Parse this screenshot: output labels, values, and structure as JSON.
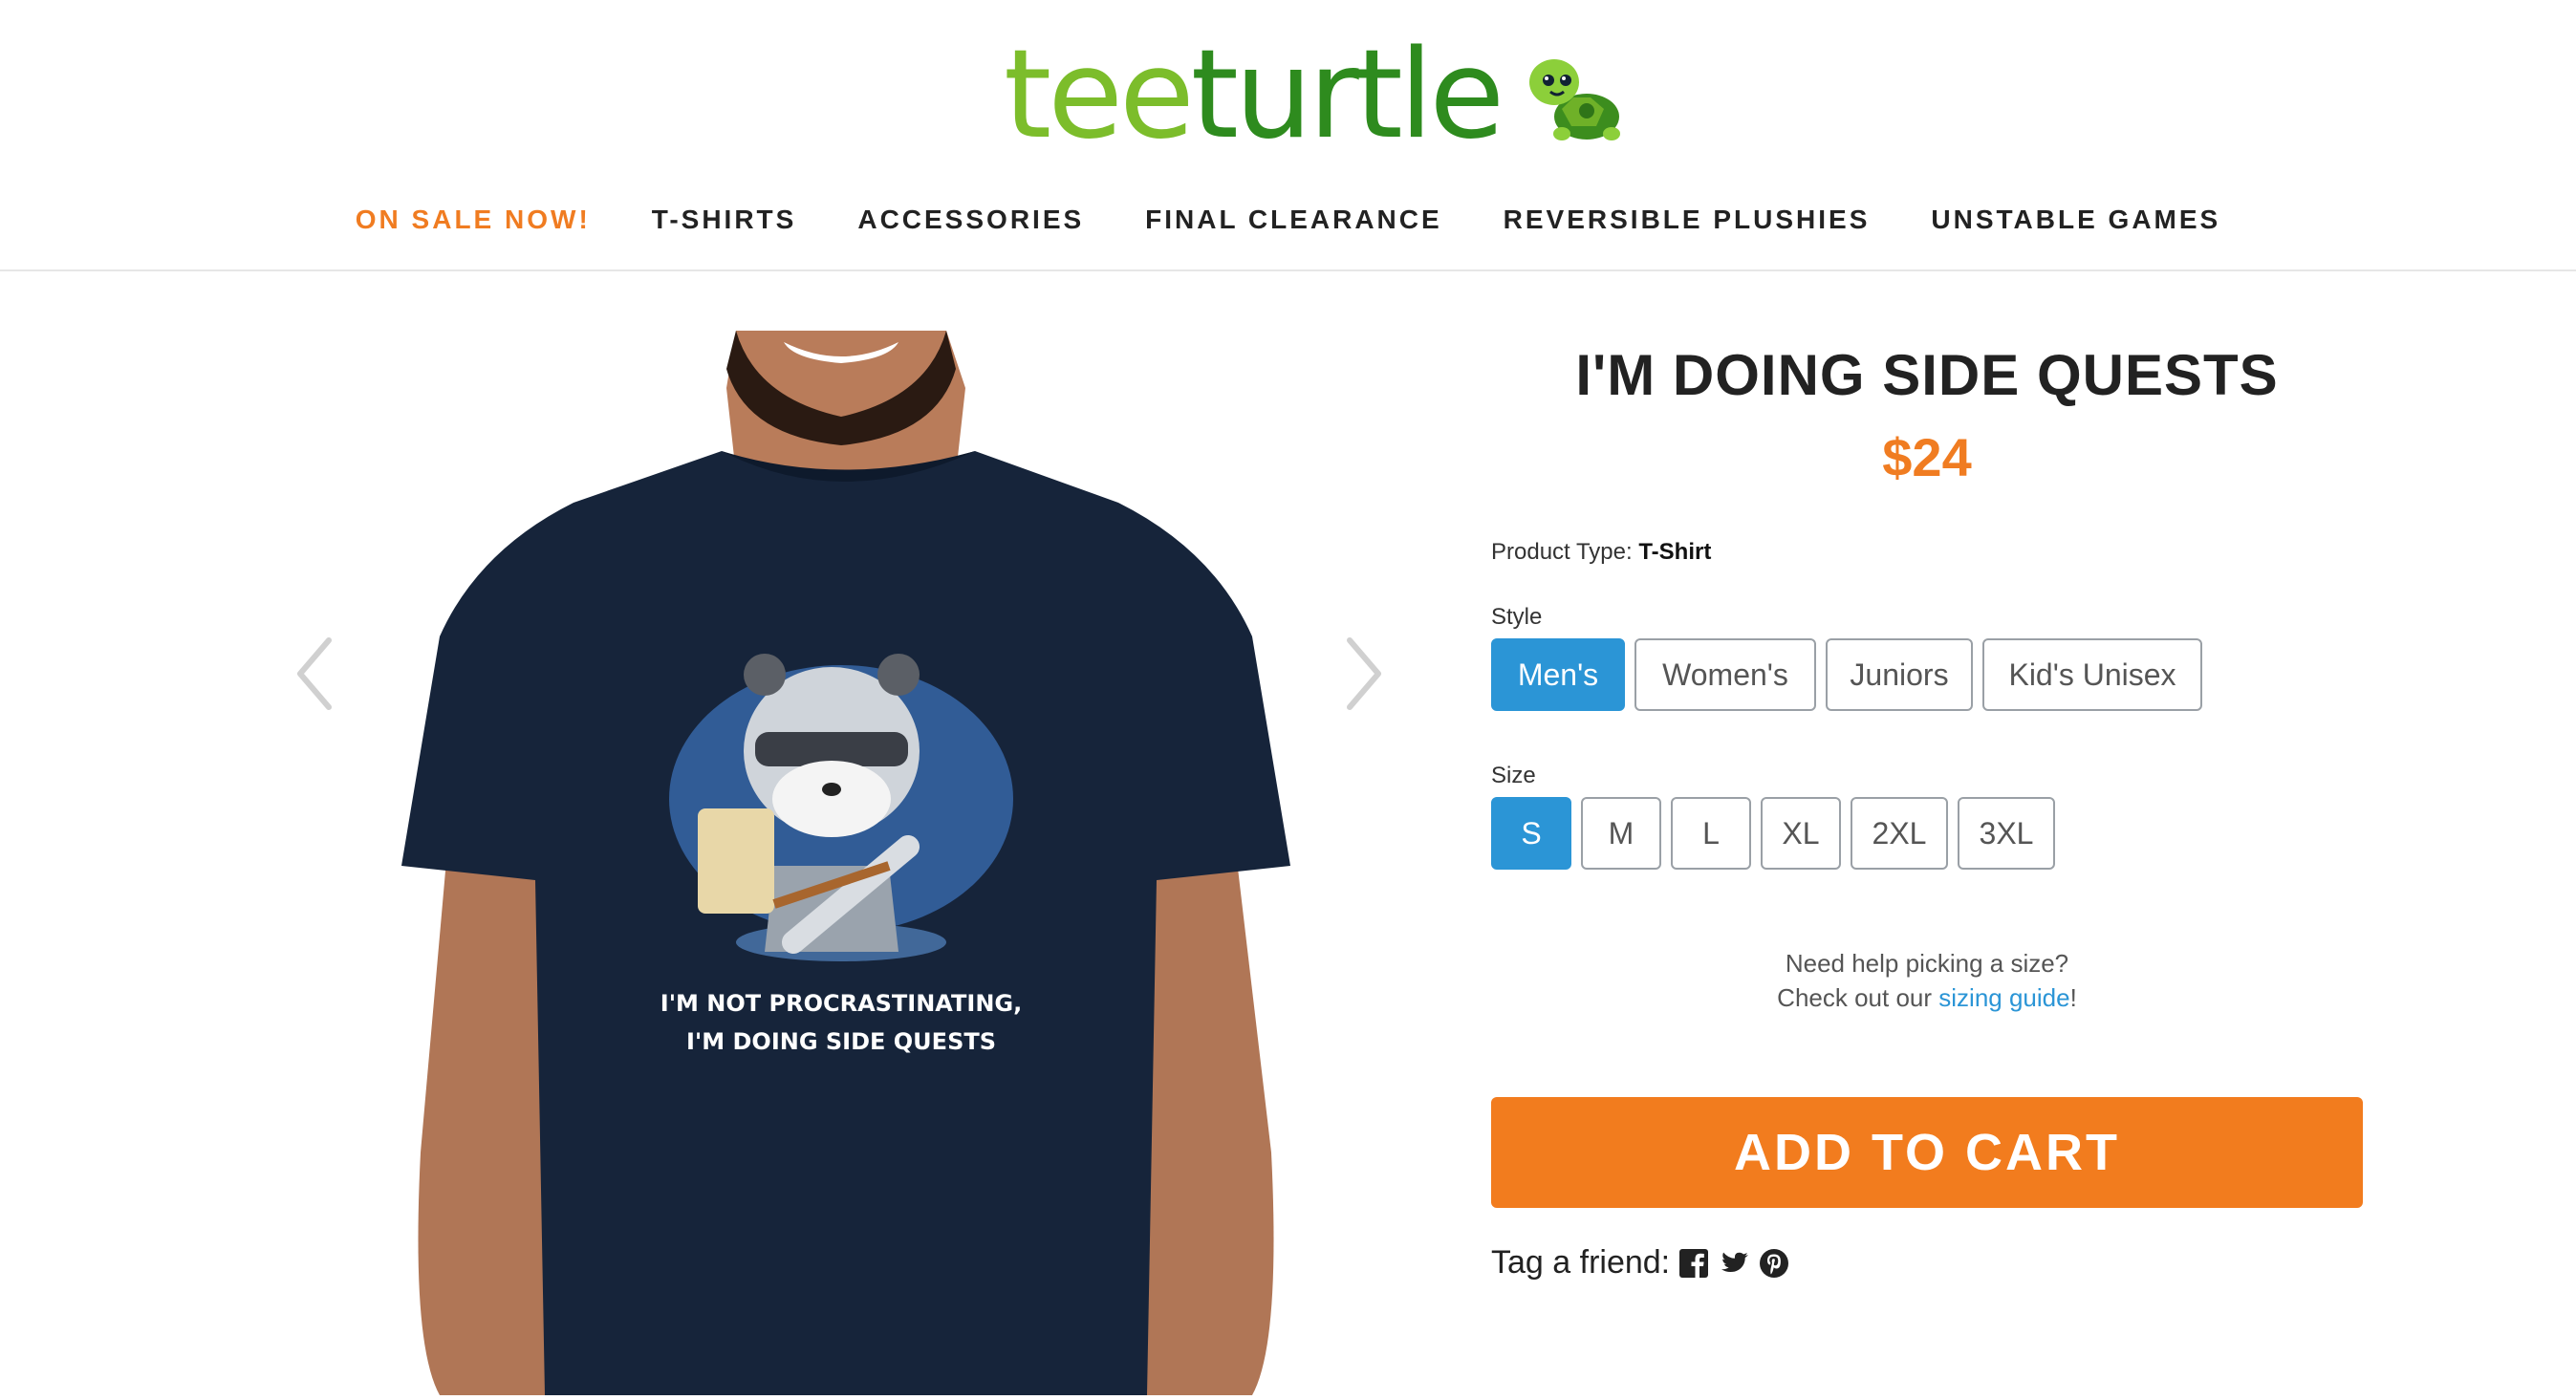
{
  "brand": {
    "logo_prefix": "tee",
    "logo_suffix": "turtle",
    "colors": {
      "tee": "#7cbd2b",
      "turtle": "#2e8b1e",
      "accent": "#f07c21",
      "select": "#2b95d6"
    }
  },
  "nav": {
    "items": [
      {
        "label": "ON SALE NOW!"
      },
      {
        "label": "T-SHIRTS"
      },
      {
        "label": "ACCESSORIES"
      },
      {
        "label": "FINAL CLEARANCE"
      },
      {
        "label": "REVERSIBLE PLUSHIES"
      },
      {
        "label": "UNSTABLE GAMES"
      }
    ]
  },
  "gallery": {
    "shirt_text_line1": "I'M NOT PROCRASTINATING,",
    "shirt_text_line2": "I'M DOING SIDE QUESTS",
    "prev_icon": "chevron-left-icon",
    "next_icon": "chevron-right-icon"
  },
  "product": {
    "title": "I'M DOING SIDE QUESTS",
    "price": "$24",
    "type_label": "Product Type:",
    "type_value": "T-Shirt",
    "style_label": "Style",
    "styles": [
      {
        "label": "Men's",
        "selected": true
      },
      {
        "label": "Women's",
        "selected": false
      },
      {
        "label": "Juniors",
        "selected": false
      },
      {
        "label": "Kid's Unisex",
        "selected": false
      }
    ],
    "size_label": "Size",
    "sizes": [
      {
        "label": "S",
        "selected": true
      },
      {
        "label": "M",
        "selected": false
      },
      {
        "label": "L",
        "selected": false
      },
      {
        "label": "XL",
        "selected": false
      },
      {
        "label": "2XL",
        "selected": false
      },
      {
        "label": "3XL",
        "selected": false
      }
    ],
    "help_line1": "Need help picking a size?",
    "help_line2_pre": "Check out our ",
    "help_link": "sizing guide",
    "help_line2_post": "!",
    "cart_label": "ADD TO CART",
    "tag_label": "Tag a friend:",
    "social_icons": [
      "facebook-icon",
      "twitter-icon",
      "pinterest-icon"
    ]
  }
}
